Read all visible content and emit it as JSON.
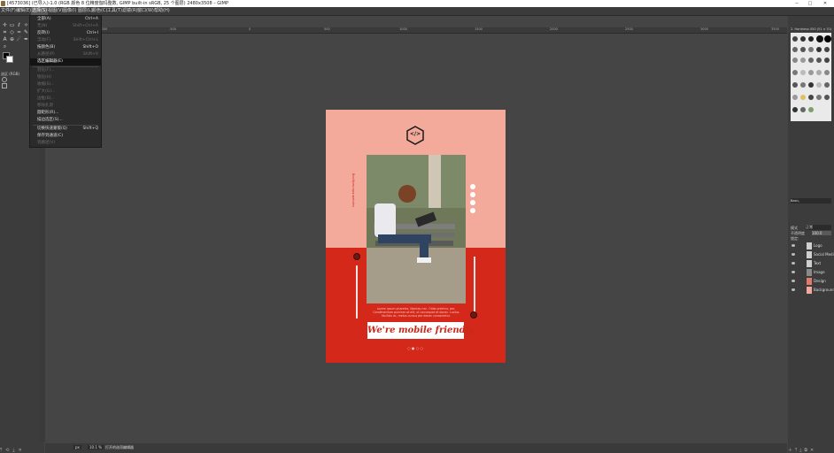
{
  "window": {
    "title": "[4573036] (已导入)-1.0 (RGB 颜色 8 位精度伽玛整数, GIMP built-in sRGB, 25 个图层) 2480x3508 – GIMP",
    "minimize": "─",
    "maximize": "□",
    "close": "✕"
  },
  "menubar": [
    "文件(F)",
    "编辑(E)",
    "选择(S)",
    "视图(V)",
    "图像(I)",
    "图层(L)",
    "颜色(C)",
    "工具(T)",
    "滤镜(R)",
    "窗口(W)",
    "帮助(H)"
  ],
  "select_menu": {
    "items": [
      {
        "label": "全部(A)",
        "shortcut": "Ctrl+A",
        "disabled": false
      },
      {
        "label": "无(N)",
        "shortcut": "Shift+Ctrl+A",
        "disabled": true
      },
      {
        "label": "反转(I)",
        "shortcut": "Ctrl+I",
        "disabled": false
      },
      {
        "label": "浮动(F)",
        "shortcut": "Shift+Ctrl+L",
        "disabled": true
      },
      {
        "label": "按颜色(B)",
        "shortcut": "Shift+O",
        "disabled": false
      },
      {
        "label": "从路径(P)",
        "shortcut": "Shift+V",
        "disabled": true
      },
      {
        "label": "选区编辑器(E)",
        "shortcut": "",
        "disabled": false,
        "highlighted": true
      },
      {
        "label": "羽化(F)...",
        "shortcut": "",
        "disabled": true
      },
      {
        "label": "锐化(H)",
        "shortcut": "",
        "disabled": true
      },
      {
        "label": "收缩(S)...",
        "shortcut": "",
        "disabled": true
      },
      {
        "label": "扩大(G)...",
        "shortcut": "",
        "disabled": true
      },
      {
        "label": "边框(B)...",
        "shortcut": "",
        "disabled": true
      },
      {
        "label": "移除孔洞",
        "shortcut": "",
        "disabled": true
      },
      {
        "label": "圆矩形(R)...",
        "shortcut": "",
        "disabled": false
      },
      {
        "label": "描边选区(S)...",
        "shortcut": "",
        "disabled": false
      },
      {
        "label": "切换快速蒙版(Q)",
        "shortcut": "Shift+Q",
        "disabled": false
      },
      {
        "label": "保存到通道(C)",
        "shortcut": "",
        "disabled": false
      },
      {
        "label": "到路径(V)",
        "shortcut": "",
        "disabled": true
      }
    ]
  },
  "toolbox": {
    "tool_options_label": "选区 (RGB)"
  },
  "ruler_labels": [
    "-1000",
    "-500",
    "0",
    "500",
    "1000",
    "1500",
    "2000",
    "2500",
    "3000",
    "3500"
  ],
  "poster": {
    "vertical_text": "Bodifyeuropa.webdev",
    "body_text": "Lorem ipsum pharetra, libertay nec. Oidia pretrina, per. Condimentum pulvinar at elit, ut consequat et donec. Luctus facilisis ac, metus cursus per donec consectetur.",
    "headline": "We're mobile friendly",
    "code_icon": "</>",
    "page_dots": "○ ● ○ ○"
  },
  "status": {
    "unit": "px",
    "zoom": "10.1 %",
    "message": "打开的选项编辑器"
  },
  "dock": {
    "brushes_title": "2. Hardness 050 (51 × 51)",
    "brushes_filter": "Basic,",
    "mode_label": "模式",
    "mode_value": "正常",
    "opacity_label": "不透明度",
    "opacity_value": "100.0",
    "lock_label": "锁定:",
    "layers": [
      {
        "name": "Logo",
        "thumb": "#cfcfcf"
      },
      {
        "name": "Social Media",
        "thumb": "#cfcfcf"
      },
      {
        "name": "Text",
        "thumb": "#cfcfcf"
      },
      {
        "name": "Image",
        "thumb": "#8a8a8a"
      },
      {
        "name": "Design",
        "thumb": "#e07a6a"
      },
      {
        "name": "Background",
        "thumb": "#f3aa9b"
      }
    ]
  }
}
